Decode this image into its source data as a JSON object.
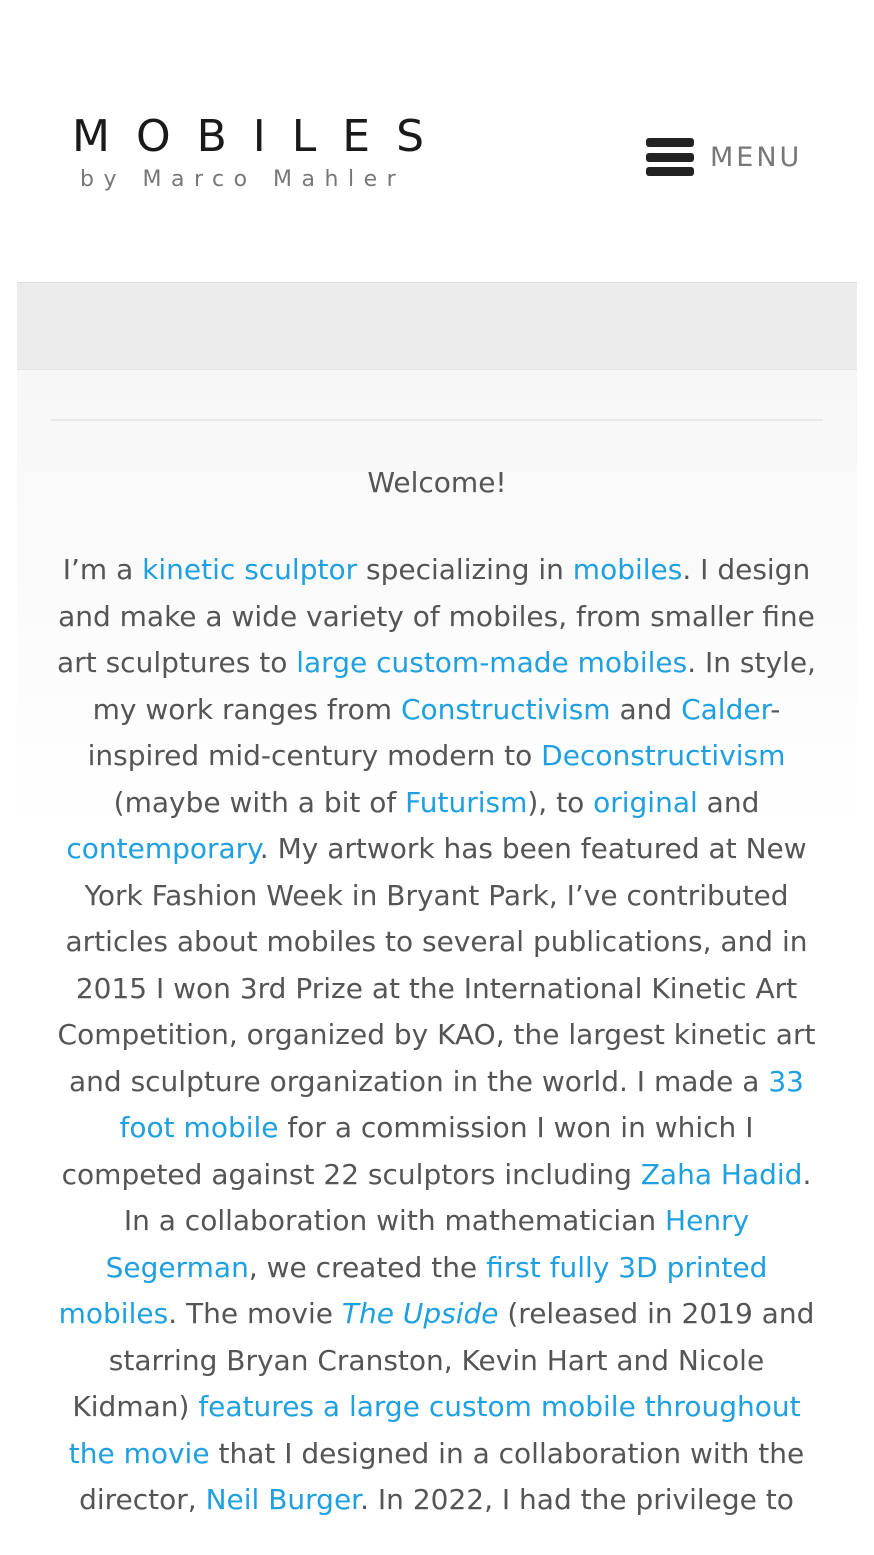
{
  "header": {
    "logo_title": "MOBILES",
    "logo_subtitle": "by Marco Mahler",
    "menu_label": "MENU",
    "menu_icon": "hamburger-icon"
  },
  "content": {
    "welcome": "Welcome!",
    "paragraph": [
      {
        "t": "text",
        "v": "I’m a "
      },
      {
        "t": "link",
        "v": "kinetic sculptor"
      },
      {
        "t": "text",
        "v": " specializing in "
      },
      {
        "t": "link",
        "v": "mobiles"
      },
      {
        "t": "text",
        "v": ". I design and make a wide variety of mobiles, from smaller fine art sculptures to "
      },
      {
        "t": "link",
        "v": "large custom-made mobiles"
      },
      {
        "t": "text",
        "v": ". In style, my work ranges from "
      },
      {
        "t": "link",
        "v": "Constructivism"
      },
      {
        "t": "text",
        "v": " and "
      },
      {
        "t": "link",
        "v": "Calder"
      },
      {
        "t": "text",
        "v": "-inspired mid-century modern to "
      },
      {
        "t": "link",
        "v": "Deconstructivism"
      },
      {
        "t": "text",
        "v": " (maybe with a bit of "
      },
      {
        "t": "link",
        "v": "Futurism"
      },
      {
        "t": "text",
        "v": "), to "
      },
      {
        "t": "link",
        "v": "original"
      },
      {
        "t": "text",
        "v": " and "
      },
      {
        "t": "link",
        "v": "contemporary"
      },
      {
        "t": "text",
        "v": ". My artwork has been featured at New York Fashion Week in Bryant Park, I’ve contributed articles about mobiles to several publications, and in 2015 I won 3rd Prize at the International Kinetic Art Competition, organized by KAO, the largest kinetic art and sculpture organization in the world. I made a "
      },
      {
        "t": "link",
        "v": "33 foot mobile"
      },
      {
        "t": "text",
        "v": " for a commission I won in which I competed against 22 sculptors including "
      },
      {
        "t": "link",
        "v": "Zaha Hadid"
      },
      {
        "t": "text",
        "v": ". In a collaboration with mathematician "
      },
      {
        "t": "link",
        "v": "Henry Segerman"
      },
      {
        "t": "text",
        "v": ", we created the "
      },
      {
        "t": "link",
        "v": "first fully 3D printed mobiles"
      },
      {
        "t": "text",
        "v": ". The movie "
      },
      {
        "t": "link-italic",
        "v": "The Upside"
      },
      {
        "t": "text",
        "v": " (released in 2019 and starring Bryan Cranston, Kevin Hart and Nicole Kidman) "
      },
      {
        "t": "link",
        "v": "features a large custom mobile throughout the movie"
      },
      {
        "t": "text",
        "v": " that I designed in a collaboration with the director, "
      },
      {
        "t": "link",
        "v": "Neil Burger"
      },
      {
        "t": "text",
        "v": ". In 2022, I had the privilege to"
      }
    ]
  },
  "colors": {
    "link": "#1fa0e0",
    "text": "#555555",
    "band": "#ececec"
  }
}
